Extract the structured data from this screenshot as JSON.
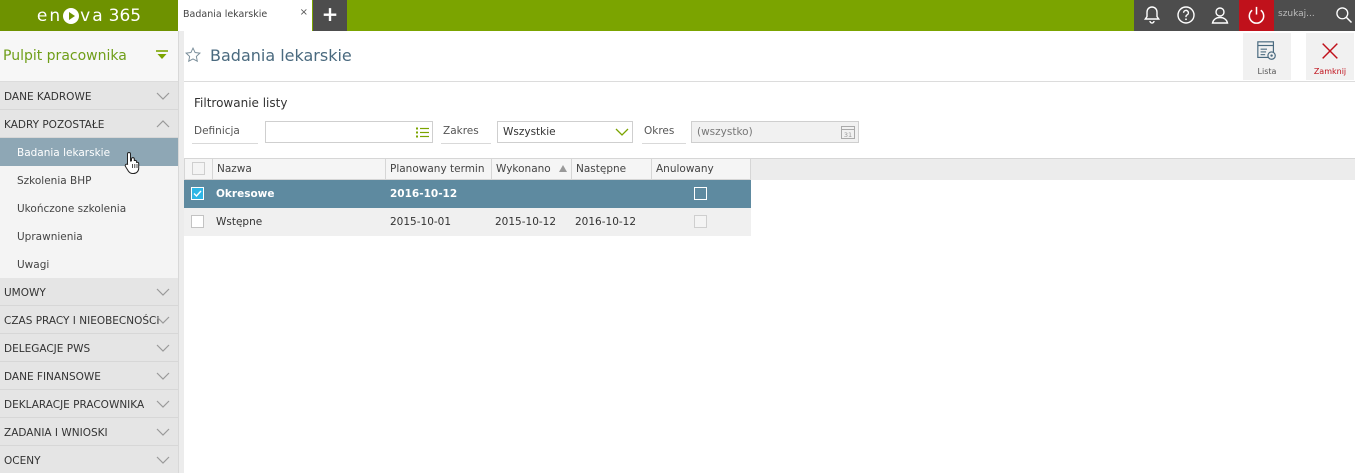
{
  "app": {
    "logo_text_left": "en",
    "logo_text_right": "va",
    "logo_number": "365"
  },
  "tabs": [
    {
      "label": "Badania lekarskie",
      "close": "×"
    }
  ],
  "add_tab": "+",
  "search": {
    "placeholder": "szukaj..."
  },
  "sidebar": {
    "title": "Pulpit pracownika",
    "sections": [
      {
        "label": "DANE KADROWE",
        "expanded": false
      },
      {
        "label": "KADRY POZOSTAŁE",
        "expanded": true
      },
      {
        "label": "UMOWY",
        "expanded": false
      },
      {
        "label": "CZAS PRACY I NIEOBECNOŚCI",
        "expanded": false
      },
      {
        "label": "DELEGACJE PWS",
        "expanded": false
      },
      {
        "label": "DANE FINANSOWE",
        "expanded": false
      },
      {
        "label": "DEKLARACJE PRACOWNIKA",
        "expanded": false
      },
      {
        "label": "ZADANIA I WNIOSKI",
        "expanded": false
      },
      {
        "label": "OCENY",
        "expanded": false
      }
    ],
    "sub_items": [
      {
        "label": "Badania lekarskie",
        "active": true
      },
      {
        "label": "Szkolenia BHP",
        "active": false
      },
      {
        "label": "Ukończone szkolenia",
        "active": false
      },
      {
        "label": "Uprawnienia",
        "active": false
      },
      {
        "label": "Uwagi",
        "active": false
      }
    ]
  },
  "header": {
    "title": "Badania lekarskie"
  },
  "toolbar": {
    "list_label": "Lista",
    "close_label": "Zamknij"
  },
  "filter": {
    "title": "Filtrowanie listy",
    "definicja_label": "Definicja",
    "definicja_value": "",
    "zakres_label": "Zakres",
    "zakres_value": "Wszystkie",
    "okres_label": "Okres",
    "okres_value": "(wszystko)"
  },
  "grid": {
    "columns": [
      "Nazwa",
      "Planowany termin",
      "Wykonano",
      "Następne",
      "Anulowany"
    ],
    "rows": [
      {
        "nazwa": "Okresowe",
        "planowany": "2016-10-12",
        "wykonano": "",
        "nastepne": "",
        "anulowany": false,
        "selected": true
      },
      {
        "nazwa": "Wstępne",
        "planowany": "2015-10-01",
        "wykonano": "2015-10-12",
        "nastepne": "2016-10-12",
        "anulowany": false,
        "selected": false
      }
    ]
  },
  "colors": {
    "brand": "#7ba400",
    "selected_row": "#5e8aa0",
    "active_nav": "#8ea7b5",
    "close_red": "#c0111b"
  }
}
